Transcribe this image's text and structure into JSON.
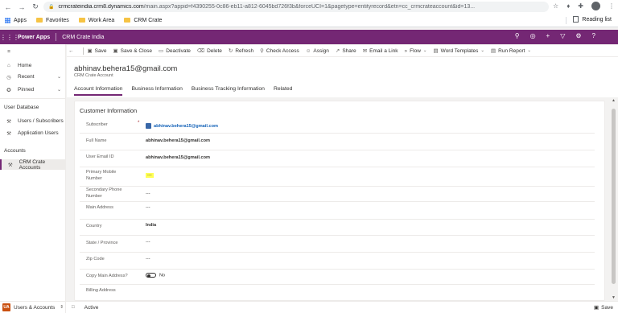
{
  "browser": {
    "url_host": "crmcrateindia.crm8.dynamics.com",
    "url_path": "/main.aspx?appid=f4390255-0c86-eb11-a812-6045bd726f3b&forceUCI=1&pagetype=entityrecord&etn=cc_crmcrateaccount&id=13...",
    "bookmarks": [
      {
        "label": "Apps",
        "icon": "apps-grid-icon"
      },
      {
        "label": "Favorites",
        "icon": "folder-icon"
      },
      {
        "label": "Work Area",
        "icon": "folder-icon"
      },
      {
        "label": "CRM Crate",
        "icon": "folder-icon"
      }
    ],
    "reading_list": "Reading list"
  },
  "header": {
    "product": "Power Apps",
    "app_name": "CRM Crate India"
  },
  "leftnav": {
    "top_items": [
      {
        "label": "Home",
        "icon": "home-icon",
        "chevron": false
      },
      {
        "label": "Recent",
        "icon": "clock-icon",
        "chevron": true
      },
      {
        "label": "Pinned",
        "icon": "pin-icon",
        "chevron": true
      }
    ],
    "groups": [
      {
        "title": "User Database",
        "items": [
          {
            "label": "Users / Subscribers",
            "icon": "tools-icon"
          },
          {
            "label": "Application Users",
            "icon": "tools-icon"
          }
        ]
      },
      {
        "title": "Accounts",
        "items": [
          {
            "label": "CRM Crate Accounts",
            "icon": "tools-icon",
            "active": true
          }
        ]
      }
    ]
  },
  "commands": [
    {
      "label": "Save",
      "icon": "save-icon"
    },
    {
      "label": "Save & Close",
      "icon": "save-close-icon"
    },
    {
      "label": "Deactivate",
      "icon": "deactivate-icon"
    },
    {
      "label": "Delete",
      "icon": "delete-icon"
    },
    {
      "label": "Refresh",
      "icon": "refresh-icon"
    },
    {
      "label": "Check Access",
      "icon": "check-access-icon"
    },
    {
      "label": "Assign",
      "icon": "assign-icon"
    },
    {
      "label": "Share",
      "icon": "share-icon"
    },
    {
      "label": "Email a Link",
      "icon": "email-icon"
    },
    {
      "label": "Flow",
      "icon": "flow-icon",
      "dropdown": true
    },
    {
      "label": "Word Templates",
      "icon": "word-icon",
      "dropdown": true
    },
    {
      "label": "Run Report",
      "icon": "report-icon",
      "dropdown": true
    }
  ],
  "record": {
    "title": "abhinav.behera15@gmail.com",
    "entity": "CRM Crate Account"
  },
  "tabs": [
    "Account Information",
    "Business Information",
    "Business Tracking Information",
    "Related"
  ],
  "section": {
    "title": "Customer Information",
    "fields": [
      {
        "label": "Subscriber",
        "value": "abhinav.behera15@gmail.com",
        "kind": "lookup",
        "required": "*"
      },
      {
        "label": "Full Name",
        "value": "abhinav.behera15@gmail.com",
        "kind": "bold"
      },
      {
        "label": "User Email ID",
        "value": "abhinav.behera15@gmail.com",
        "kind": "bold"
      },
      {
        "label": "Primary Mobile Number",
        "value": "---",
        "kind": "highlight"
      },
      {
        "label": "Secondary Phone Number",
        "value": "---",
        "kind": "dash"
      },
      {
        "label": "Main Address",
        "value": "---",
        "kind": "dash"
      },
      {
        "label": "Country",
        "value": "India",
        "kind": "bold"
      },
      {
        "label": "State / Province",
        "value": "---",
        "kind": "dash"
      },
      {
        "label": "Zip Code",
        "value": "---",
        "kind": "dash"
      },
      {
        "label": "Copy Main Address?",
        "value": "No",
        "kind": "toggle"
      },
      {
        "label": "Billing Address",
        "value": "",
        "kind": "dash"
      }
    ]
  },
  "status": {
    "area": "Users & Accounts",
    "area_badge": "UA",
    "record_status": "Active",
    "save_label": "Save"
  }
}
